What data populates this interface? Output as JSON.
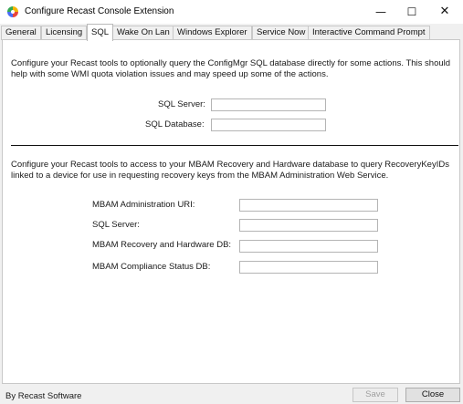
{
  "window": {
    "title": "Configure Recast Console Extension",
    "minimize_glyph": "—",
    "maximize_glyph": "☐",
    "close_glyph": "✕"
  },
  "tabs": [
    {
      "label": "General"
    },
    {
      "label": "Licensing"
    },
    {
      "label": "SQL",
      "active": true
    },
    {
      "label": "Wake On Lan"
    },
    {
      "label": "Windows Explorer"
    },
    {
      "label": "Service Now"
    },
    {
      "label": "Interactive Command Prompt"
    }
  ],
  "sql": {
    "description": "Configure your Recast tools to optionally query the ConfigMgr SQL database directly for some actions. This should help with some WMI quota violation issues and may speed up some of the actions.",
    "server_label": "SQL Server:",
    "server_value": "",
    "database_label": "SQL Database:",
    "database_value": ""
  },
  "mbam": {
    "description": "Configure your Recast tools to access to your MBAM Recovery and Hardware database to query RecoveryKeyIDs linked to a device for use in requesting recovery keys from the MBAM Administration Web Service.",
    "admin_uri_label": "MBAM Administration URI:",
    "admin_uri_value": "",
    "sql_server_label": "SQL Server:",
    "sql_server_value": "",
    "recovery_db_label": "MBAM Recovery and Hardware DB:",
    "recovery_db_value": "",
    "compliance_db_label": "MBAM Compliance Status DB:",
    "compliance_db_value": ""
  },
  "footer": {
    "brand": "By Recast Software",
    "save_label": "Save",
    "close_label": "Close"
  }
}
